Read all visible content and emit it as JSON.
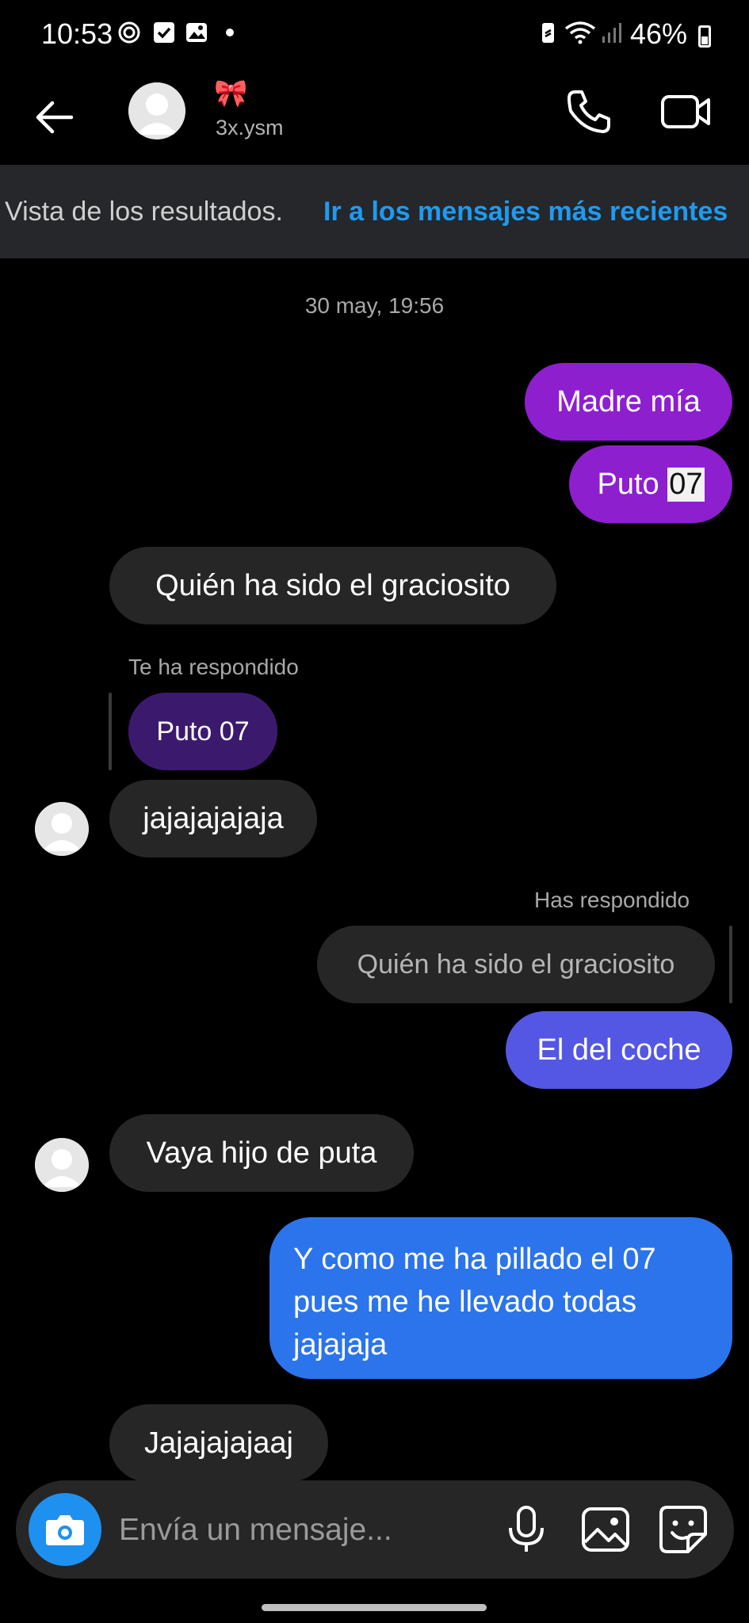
{
  "status_bar": {
    "time": "10:53",
    "battery": "46%",
    "icons": [
      "pinwheel-icon",
      "checkbox-icon",
      "gallery-icon",
      "dot-icon",
      "battery-saver-icon",
      "wifi-icon",
      "signal-icon",
      "battery-icon"
    ]
  },
  "header": {
    "emoji": "🎀",
    "username": "3x.ysm",
    "icons": [
      "back-arrow-icon",
      "phone-icon",
      "video-camera-icon"
    ]
  },
  "banner": {
    "text": "Vista de los resultados.",
    "link": "Ir a los mensajes más recientes"
  },
  "thread": {
    "timestamp": "30 may, 19:56",
    "msg1": "Madre mía",
    "msg2_text": "Puto ",
    "msg2_highlight": "07",
    "msg3": "Quién ha sido el graciosito",
    "reply_in_caption": "Te ha respondido",
    "reply_in_quote": "Puto 07",
    "msg4": "jajajajajaja",
    "reply_out_caption": "Has respondido",
    "reply_out_quote": "Quién ha sido el graciosito",
    "msg5": "El del coche",
    "msg6": "Vaya hijo de puta",
    "msg7": "Y como me ha pillado el 07 pues me he llevado todas jajajaja",
    "msg8": "Jajajajajaaj"
  },
  "colors": {
    "purple": "#8d1fcf",
    "indigo": "#5457e3",
    "blue": "#2b74eb",
    "incoming": "#262626",
    "link": "#1e9bf0"
  },
  "composer": {
    "placeholder": "Envía un mensaje..."
  }
}
